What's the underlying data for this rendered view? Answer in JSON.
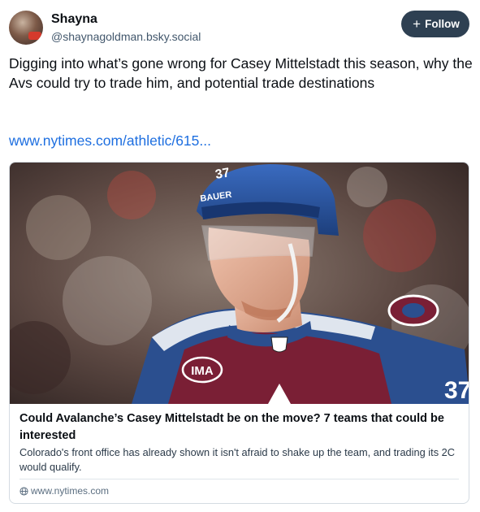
{
  "author": {
    "display_name": "Shayna",
    "handle": "@shaynagoldman.bsky.social"
  },
  "follow_button": {
    "icon": "plus",
    "label": "Follow"
  },
  "post": {
    "text": "Digging into what’s gone wrong for Casey Mittelstadt this season, why the Avs could try to trade him, and potential trade destinations",
    "link": "www.nytimes.com/athletic/615..."
  },
  "embed": {
    "image_alt": "hockey-player-photo",
    "helmet_brand": "BAUER",
    "helmet_number": "37",
    "jersey_patch": "IMA",
    "sleeve_number": "37",
    "title": "Could Avalanche’s Casey Mittelstadt be on the move? 7 teams that could be interested",
    "description": "Colorado's front office has already shown it isn't afraid to shake up the team, and trading its 2C would qualify.",
    "domain": "www.nytimes.com",
    "domain_icon": "globe-icon"
  },
  "colors": {
    "follow_bg": "#2e4052",
    "link": "#1e6fe0",
    "jersey_burgundy": "#7a1f35",
    "jersey_blue": "#2b4f8f"
  }
}
